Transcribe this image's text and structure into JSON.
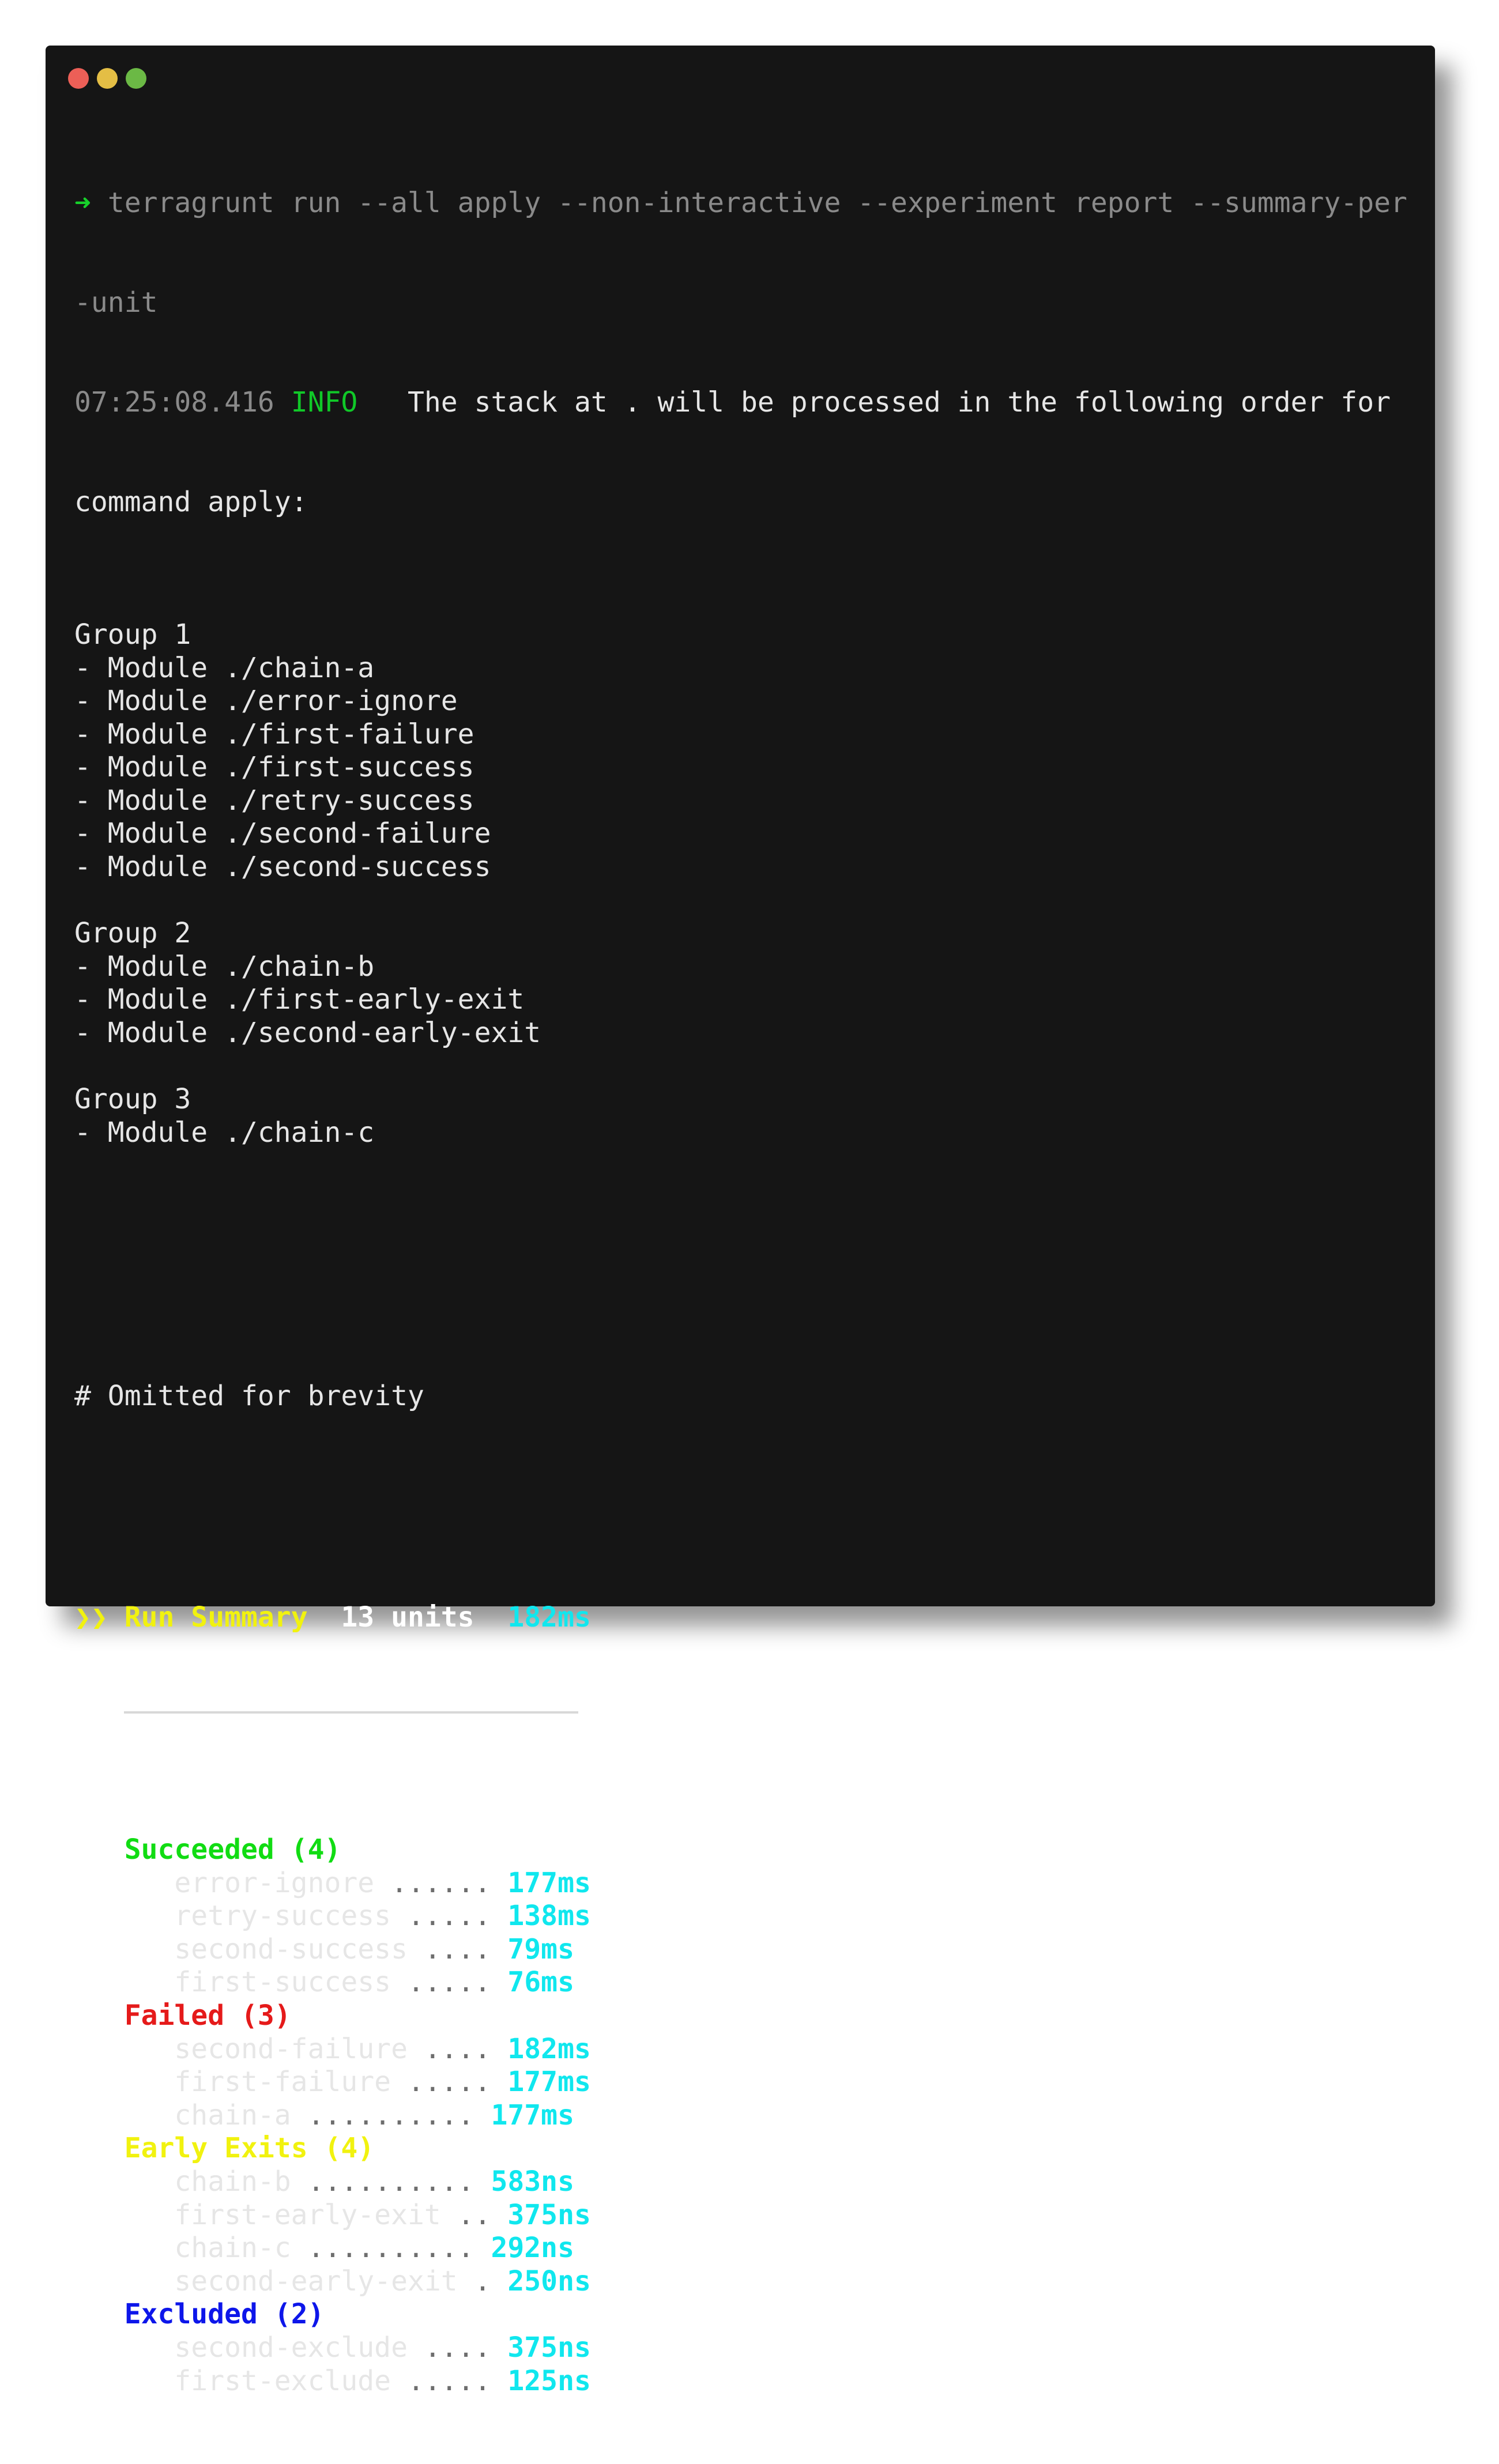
{
  "command": {
    "prompt": "➜",
    "line1": "terragrunt run --all apply --non-interactive --experiment report --summary-per",
    "line2": "-unit"
  },
  "log": {
    "timestamp": "07:25:08.416",
    "level": "INFO",
    "message": "  The stack at . will be processed in the following order for",
    "message_cont": "command apply:"
  },
  "groups": [
    {
      "title": "Group 1",
      "modules": [
        "- Module ./chain-a",
        "- Module ./error-ignore",
        "- Module ./first-failure",
        "- Module ./first-success",
        "- Module ./retry-success",
        "- Module ./second-failure",
        "- Module ./second-success"
      ]
    },
    {
      "title": "Group 2",
      "modules": [
        "- Module ./chain-b",
        "- Module ./first-early-exit",
        "- Module ./second-early-exit"
      ]
    },
    {
      "title": "Group 3",
      "modules": [
        "- Module ./chain-c"
      ]
    }
  ],
  "comment": "# Omitted for brevity",
  "summary": {
    "marker": "❯❯",
    "title": "Run Summary",
    "units": "13 units",
    "duration": "182ms",
    "sections": [
      {
        "label": "Succeeded (4)",
        "color": "#11dc13",
        "items": [
          {
            "name": "error-ignore",
            "dots": " ......",
            "time": "177ms"
          },
          {
            "name": "retry-success",
            "dots": " .....",
            "time": "138ms"
          },
          {
            "name": "second-success",
            "dots": " ....",
            "time": "79ms"
          },
          {
            "name": "first-success",
            "dots": " .....",
            "time": "76ms"
          }
        ]
      },
      {
        "label": "Failed (3)",
        "color": "#e51a1a",
        "items": [
          {
            "name": "second-failure",
            "dots": " ....",
            "time": "182ms"
          },
          {
            "name": "first-failure",
            "dots": " .....",
            "time": "177ms"
          },
          {
            "name": "chain-a",
            "dots": " ..........",
            "time": "177ms"
          }
        ]
      },
      {
        "label": "Early Exits (4)",
        "color": "#f1f20f",
        "items": [
          {
            "name": "chain-b",
            "dots": " ..........",
            "time": "583ns"
          },
          {
            "name": "first-early-exit",
            "dots": " ..",
            "time": "375ns"
          },
          {
            "name": "chain-c",
            "dots": " ..........",
            "time": "292ns"
          },
          {
            "name": "second-early-exit",
            "dots": " .",
            "time": "250ns"
          }
        ]
      },
      {
        "label": "Excluded (2)",
        "color": "#0d16ea",
        "items": [
          {
            "name": "second-exclude",
            "dots": " ....",
            "time": "375ns"
          },
          {
            "name": "first-exclude",
            "dots": " .....",
            "time": "125ns"
          }
        ]
      }
    ]
  },
  "colors": {
    "background": "#151515",
    "text": "#e6e6e6",
    "duration": "#10e7ee",
    "summary_title": "#f1f20f"
  },
  "window_controls": [
    "close-dot",
    "minimize-dot",
    "maximize-dot"
  ]
}
